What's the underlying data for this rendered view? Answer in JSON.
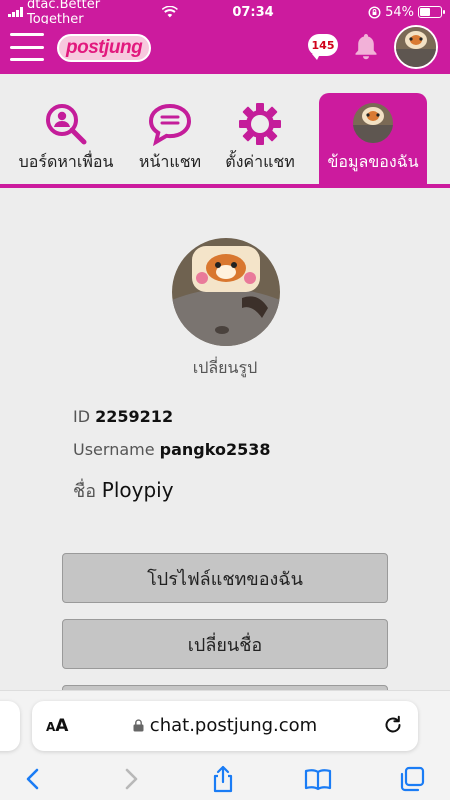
{
  "status": {
    "carrier": "dtac.Better Together",
    "time": "07:34",
    "battery": "54%",
    "battery_level": 0.54
  },
  "header": {
    "logo": "postjung",
    "chat_count": "145"
  },
  "tabs": [
    {
      "label": "บอร์ดหาเพื่อน",
      "icon": "search-user-icon"
    },
    {
      "label": "หน้าแชท",
      "icon": "chat-bubble-icon"
    },
    {
      "label": "ตั้งค่าแชท",
      "icon": "gear-icon"
    },
    {
      "label": "ข้อมูลของฉัน",
      "icon": "avatar"
    }
  ],
  "profile": {
    "change_photo": "เปลี่ยนรูป",
    "id_label": "ID",
    "id_value": "2259212",
    "username_label": "Username",
    "username_value": "pangko2538",
    "name_label": "ชื่อ",
    "name_value": "Ploypiy"
  },
  "buttons": {
    "chat_profile": "โปรไฟล์แชทของฉัน",
    "change_name": "เปลี่ยนชื่อ"
  },
  "browser": {
    "aa": "AA",
    "url": "chat.postjung.com"
  },
  "colors": {
    "brand": "#cc1b9e",
    "button_bg": "#c5c5c5",
    "page_bg": "#ededed"
  }
}
